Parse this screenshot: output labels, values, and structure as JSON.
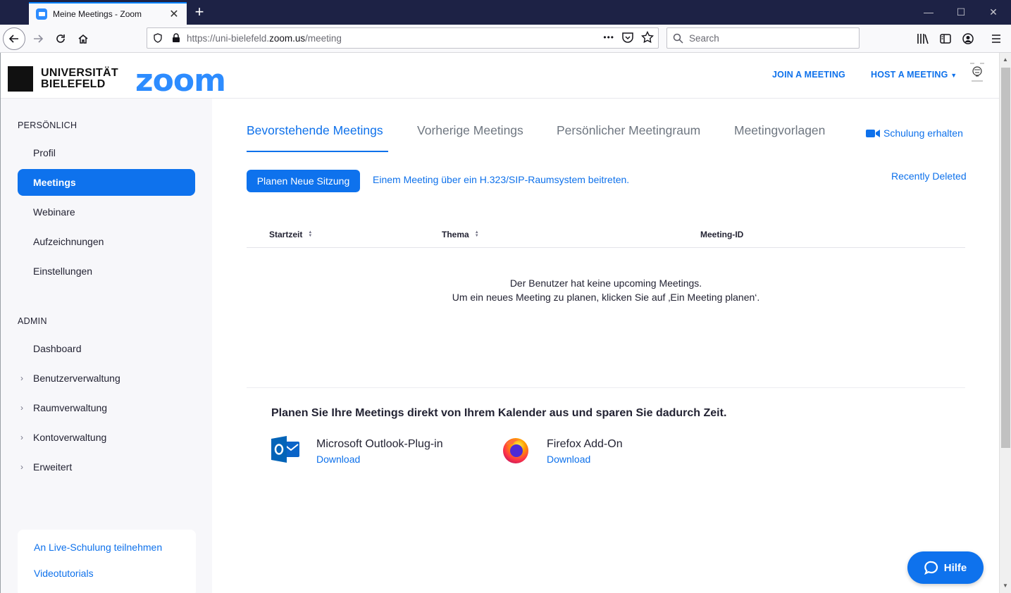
{
  "browser": {
    "tab_title": "Meine Meetings - Zoom",
    "tab_close": "✕",
    "new_tab": "+",
    "window_min": "—",
    "window_max": "☐",
    "window_close": "✕",
    "url_prefix": "https://uni-bielefeld.",
    "url_domain": "zoom.us",
    "url_path": "/meeting",
    "page_actions": "•••",
    "search_placeholder": "Search"
  },
  "header": {
    "uni_line1": "UNIVERSITÄT",
    "uni_line2": "BIELEFELD",
    "zoom_logo": "zoom",
    "join_meeting": "JOIN A MEETING",
    "host_meeting": "HOST A MEETING"
  },
  "sidebar": {
    "personal_title": "PERSÖNLICH",
    "personal_items": [
      "Profil",
      "Meetings",
      "Webinare",
      "Aufzeichnungen",
      "Einstellungen"
    ],
    "admin_title": "ADMIN",
    "admin_items": [
      "Dashboard",
      "Benutzerverwaltung",
      "Raumverwaltung",
      "Kontoverwaltung",
      "Erweitert"
    ],
    "help_links": [
      "An Live-Schulung teilnehmen",
      "Videotutorials"
    ]
  },
  "main": {
    "tabs": [
      "Bevorstehende Meetings",
      "Vorherige Meetings",
      "Persönlicher Meetingraum",
      "Meetingvorlagen"
    ],
    "training_link": "Schulung erhalten",
    "schedule_button": "Planen Neue Sitzung",
    "sip_link": "Einem Meeting über ein H.323/SIP-Raumsystem beitreten.",
    "recently_deleted": "Recently Deleted",
    "columns": [
      "Startzeit",
      "Thema",
      "Meeting-ID"
    ],
    "empty_line1": "Der Benutzer hat keine upcoming Meetings.",
    "empty_line2": "Um ein neues Meeting zu planen, klicken Sie auf ‚Ein Meeting planen‘.",
    "calendar_title": "Planen Sie Ihre Meetings direkt von Ihrem Kalender aus und sparen Sie dadurch Zeit.",
    "plugins": [
      {
        "name": "Microsoft Outlook-Plug-in",
        "link": "Download"
      },
      {
        "name": "Firefox Add-On",
        "link": "Download"
      }
    ],
    "help_button": "Hilfe"
  },
  "colors": {
    "accent": "#0e72ed",
    "link": "#0e71eb",
    "zoom_brand": "#2d8cff",
    "titlebar": "#1d2245"
  }
}
